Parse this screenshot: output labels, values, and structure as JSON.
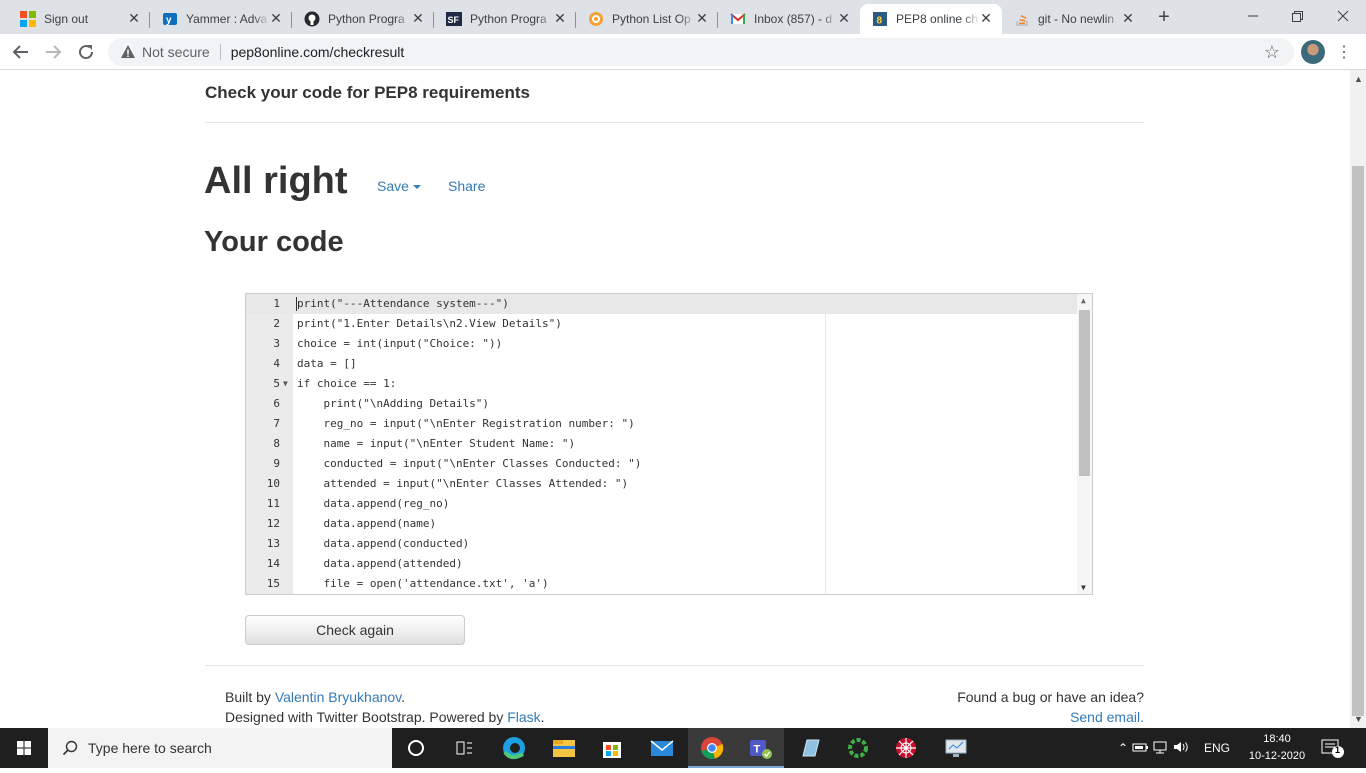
{
  "browser": {
    "tabs": [
      {
        "title": "Sign out",
        "favicon": "microsoft-icon",
        "active": false
      },
      {
        "title": "Yammer : Adva",
        "favicon": "yammer-icon",
        "active": false
      },
      {
        "title": "Python Progra",
        "favicon": "github-icon",
        "active": false
      },
      {
        "title": "Python Progra",
        "favicon": "sf-icon",
        "active": false
      },
      {
        "title": "Python List Op",
        "favicon": "w3-icon",
        "active": false
      },
      {
        "title": "Inbox (857) - d",
        "favicon": "gmail-icon",
        "active": false
      },
      {
        "title": "PEP8 online ch",
        "favicon": "pep8-icon",
        "active": true
      },
      {
        "title": "git - No newlin",
        "favicon": "stackoverflow-icon",
        "active": false
      }
    ],
    "omnibox": {
      "security_label": "Not secure",
      "url": "pep8online.com/checkresult"
    }
  },
  "page": {
    "brand": "Check your code for PEP8 requirements",
    "result_heading": "All right",
    "save_label": "Save",
    "share_label": "Share",
    "code_heading": "Your code",
    "check_again_label": "Check again",
    "footer": {
      "built_by_prefix": "Built by ",
      "author": "Valentin Bryukhanov",
      "built_by_suffix": ".",
      "designed_prefix": "Designed with Twitter Bootstrap. Powered by ",
      "flask": "Flask",
      "designed_suffix": ".",
      "bug_text": "Found a bug or have an idea?",
      "send_email": "Send email."
    }
  },
  "editor": {
    "lines": [
      {
        "n": "1",
        "text": "print(\"---Attendance system---\")"
      },
      {
        "n": "2",
        "text": "print(\"1.Enter Details\\n2.View Details\")"
      },
      {
        "n": "3",
        "text": "choice = int(input(\"Choice: \"))"
      },
      {
        "n": "4",
        "text": "data = []"
      },
      {
        "n": "5",
        "text": "if choice == 1:"
      },
      {
        "n": "6",
        "text": "    print(\"\\nAdding Details\")"
      },
      {
        "n": "7",
        "text": "    reg_no = input(\"\\nEnter Registration number: \")"
      },
      {
        "n": "8",
        "text": "    name = input(\"\\nEnter Student Name: \")"
      },
      {
        "n": "9",
        "text": "    conducted = input(\"\\nEnter Classes Conducted: \")"
      },
      {
        "n": "10",
        "text": "    attended = input(\"\\nEnter Classes Attended: \")"
      },
      {
        "n": "11",
        "text": "    data.append(reg_no)"
      },
      {
        "n": "12",
        "text": "    data.append(name)"
      },
      {
        "n": "13",
        "text": "    data.append(conducted)"
      },
      {
        "n": "14",
        "text": "    data.append(attended)"
      },
      {
        "n": "15",
        "text": "    file = open('attendance.txt', 'a')"
      }
    ]
  },
  "taskbar": {
    "search_placeholder": "Type here to search",
    "language": "ENG",
    "time": "18:40",
    "date": "10-12-2020",
    "notification_count": "1"
  },
  "colors": {
    "link": "#337ab7",
    "taskbar": "#1f1f1f",
    "tabstrip": "#dee1e6"
  }
}
